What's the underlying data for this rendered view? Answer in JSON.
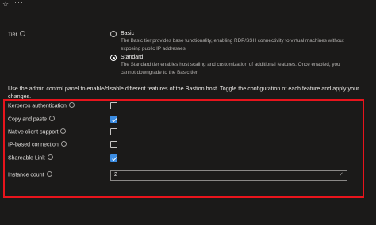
{
  "toolbar": {
    "favorite_icon": "star-icon",
    "more_label": "···"
  },
  "tier": {
    "label": "Tier",
    "options": [
      {
        "title": "Basic",
        "description": "The Basic tier provides base functionality, enabling RDP/SSH connectivity to virtual machines without exposing public IP addresses.",
        "selected": false
      },
      {
        "title": "Standard",
        "description": "The Standard tier enables host scaling and customization of additional features. Once enabled, you cannot downgrade to the Basic tier.",
        "selected": true
      }
    ]
  },
  "instructions": "Use the admin control panel to enable/disable different features of the Bastion host. Toggle the configuration of each feature and apply your changes.",
  "features": [
    {
      "label": "Kerberos authentication",
      "checked": false
    },
    {
      "label": "Copy and paste",
      "checked": true
    },
    {
      "label": "Native client support",
      "checked": false
    },
    {
      "label": "IP-based connection",
      "checked": false
    },
    {
      "label": "Shareable Link",
      "checked": true
    }
  ],
  "instance_count": {
    "label": "Instance count",
    "value": "2"
  },
  "colors": {
    "highlight_border": "#e8141c",
    "checkbox_accent": "#3c8de3",
    "background": "#1b1a19"
  }
}
